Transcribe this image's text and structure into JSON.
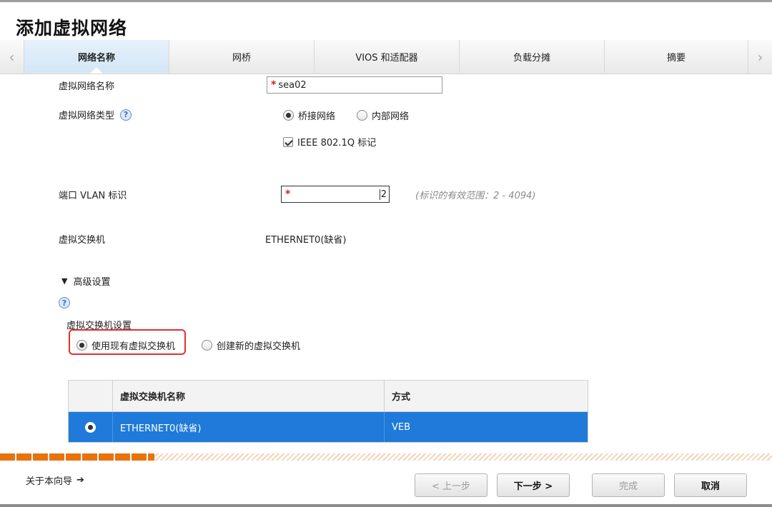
{
  "window": {
    "title": "添加虚拟网络"
  },
  "tabs": [
    {
      "label": "网络名称",
      "active": true
    },
    {
      "label": "网桥"
    },
    {
      "label": "VIOS 和适配器"
    },
    {
      "label": "负载分摊"
    },
    {
      "label": "摘要"
    }
  ],
  "form": {
    "name_label": "虚拟网络名称",
    "name_value": "sea02",
    "type_label": "虚拟网络类型",
    "type_options": {
      "bridged": "桥接网络",
      "internal": "内部网络"
    },
    "type_selected": "桥接网络",
    "ieee_label": "IEEE 802.1Q 标记",
    "ieee_checked": true,
    "vlan_label": "端口 VLAN 标识",
    "vlan_value": "2",
    "vlan_hint": "(标识的有效范围：2 - 4094)",
    "vswitch_label": "虚拟交换机",
    "vswitch_value": "ETHERNET0(缺省)"
  },
  "advanced": {
    "header": "高级设置",
    "section_label": "虚拟交换机设置",
    "options": {
      "use_existing": "使用现有虚拟交换机",
      "create_new": "创建新的虚拟交换机"
    },
    "selected": "使用现有虚拟交换机",
    "table": {
      "columns": [
        "",
        "虚拟交换机名称",
        "方式"
      ],
      "rows": [
        {
          "name": "ETHERNET0(缺省)",
          "mode": "VEB",
          "selected": true
        }
      ]
    }
  },
  "progress": {
    "fraction": 0.2
  },
  "footer": {
    "about_link": "关于本向导",
    "prev": "< 上一步",
    "next": "下一步 >",
    "finish": "完成",
    "cancel": "取消"
  },
  "colors": {
    "accent": "#1f7ad9",
    "progress": "#e8730c",
    "highlight": "#e0302f"
  }
}
